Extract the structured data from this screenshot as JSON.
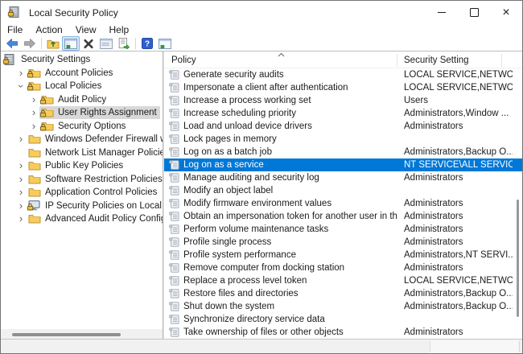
{
  "window": {
    "title": "Local Security Policy",
    "controls": [
      {
        "name": "minimize"
      },
      {
        "name": "maximize"
      },
      {
        "name": "close"
      }
    ]
  },
  "menu": {
    "items": [
      "File",
      "Action",
      "View",
      "Help"
    ]
  },
  "toolbar": {
    "buttons": [
      {
        "name": "back",
        "icon": "arrow-left"
      },
      {
        "name": "forward",
        "icon": "arrow-right"
      },
      {
        "name": "separator"
      },
      {
        "name": "up-one-level",
        "icon": "folder-up"
      },
      {
        "name": "show-console-tree",
        "icon": "window-tree",
        "pressed": true
      },
      {
        "name": "delete",
        "icon": "x-mark"
      },
      {
        "name": "properties",
        "icon": "window-plain"
      },
      {
        "name": "export-list",
        "icon": "doc-export"
      },
      {
        "name": "separator"
      },
      {
        "name": "help",
        "icon": "help"
      },
      {
        "name": "show-action-pane",
        "icon": "window-pane"
      }
    ]
  },
  "tree": {
    "items": [
      {
        "label": "Security Settings",
        "icon": "root-lock",
        "level": 0,
        "chevron": "none",
        "selected": false
      },
      {
        "label": "Account Policies",
        "icon": "folder-lock",
        "level": 1,
        "chevron": "collapsed",
        "selected": false
      },
      {
        "label": "Local Policies",
        "icon": "folder-lock",
        "level": 1,
        "chevron": "expanded",
        "selected": false
      },
      {
        "label": "Audit Policy",
        "icon": "folder-lock",
        "level": 2,
        "chevron": "collapsed",
        "selected": false
      },
      {
        "label": "User Rights Assignment",
        "icon": "folder-lock",
        "level": 2,
        "chevron": "collapsed",
        "selected": true
      },
      {
        "label": "Security Options",
        "icon": "folder-lock",
        "level": 2,
        "chevron": "collapsed",
        "selected": false
      },
      {
        "label": "Windows Defender Firewall with Advanc",
        "icon": "folder",
        "level": 1,
        "chevron": "collapsed",
        "selected": false
      },
      {
        "label": "Network List Manager Policies",
        "icon": "folder",
        "level": 1,
        "chevron": "none",
        "selected": false
      },
      {
        "label": "Public Key Policies",
        "icon": "folder",
        "level": 1,
        "chevron": "collapsed",
        "selected": false
      },
      {
        "label": "Software Restriction Policies",
        "icon": "folder",
        "level": 1,
        "chevron": "collapsed",
        "selected": false
      },
      {
        "label": "Application Control Policies",
        "icon": "folder",
        "level": 1,
        "chevron": "collapsed",
        "selected": false
      },
      {
        "label": "IP Security Policies on Local Computer",
        "icon": "ipsec",
        "level": 1,
        "chevron": "collapsed",
        "selected": false
      },
      {
        "label": "Advanced Audit Policy Configuration",
        "icon": "folder",
        "level": 1,
        "chevron": "collapsed",
        "selected": false
      }
    ]
  },
  "list": {
    "columns": [
      {
        "label": "Policy",
        "sorted": "ascending"
      },
      {
        "label": "Security Setting"
      }
    ],
    "rows": [
      {
        "policy": "Generate security audits",
        "setting": "LOCAL SERVICE,NETWOR...",
        "selected": false
      },
      {
        "policy": "Impersonate a client after authentication",
        "setting": "LOCAL SERVICE,NETWOR...",
        "selected": false
      },
      {
        "policy": "Increase a process working set",
        "setting": "Users",
        "selected": false
      },
      {
        "policy": "Increase scheduling priority",
        "setting": "Administrators,Window ...",
        "selected": false
      },
      {
        "policy": "Load and unload device drivers",
        "setting": "Administrators",
        "selected": false
      },
      {
        "policy": "Lock pages in memory",
        "setting": "",
        "selected": false
      },
      {
        "policy": "Log on as a batch job",
        "setting": "Administrators,Backup O...",
        "selected": false
      },
      {
        "policy": "Log on as a service",
        "setting": "NT SERVICE\\ALL SERVICE...",
        "selected": true
      },
      {
        "policy": "Manage auditing and security log",
        "setting": "Administrators",
        "selected": false
      },
      {
        "policy": "Modify an object label",
        "setting": "",
        "selected": false
      },
      {
        "policy": "Modify firmware environment values",
        "setting": "Administrators",
        "selected": false
      },
      {
        "policy": "Obtain an impersonation token for another user in the same ...",
        "setting": "Administrators",
        "selected": false
      },
      {
        "policy": "Perform volume maintenance tasks",
        "setting": "Administrators",
        "selected": false
      },
      {
        "policy": "Profile single process",
        "setting": "Administrators",
        "selected": false
      },
      {
        "policy": "Profile system performance",
        "setting": "Administrators,NT SERVI...",
        "selected": false
      },
      {
        "policy": "Remove computer from docking station",
        "setting": "Administrators",
        "selected": false
      },
      {
        "policy": "Replace a process level token",
        "setting": "LOCAL SERVICE,NETWOR...",
        "selected": false
      },
      {
        "policy": "Restore files and directories",
        "setting": "Administrators,Backup O...",
        "selected": false
      },
      {
        "policy": "Shut down the system",
        "setting": "Administrators,Backup O...",
        "selected": false
      },
      {
        "policy": "Synchronize directory service data",
        "setting": "",
        "selected": false
      },
      {
        "policy": "Take ownership of files or other objects",
        "setting": "Administrators",
        "selected": false
      }
    ]
  },
  "colors": {
    "list_selection": "#0078d7",
    "tree_selection": "#d8d8d8",
    "folder_gold": "#f6cd5c",
    "toolbar_pressed": "#d9e7f7"
  }
}
